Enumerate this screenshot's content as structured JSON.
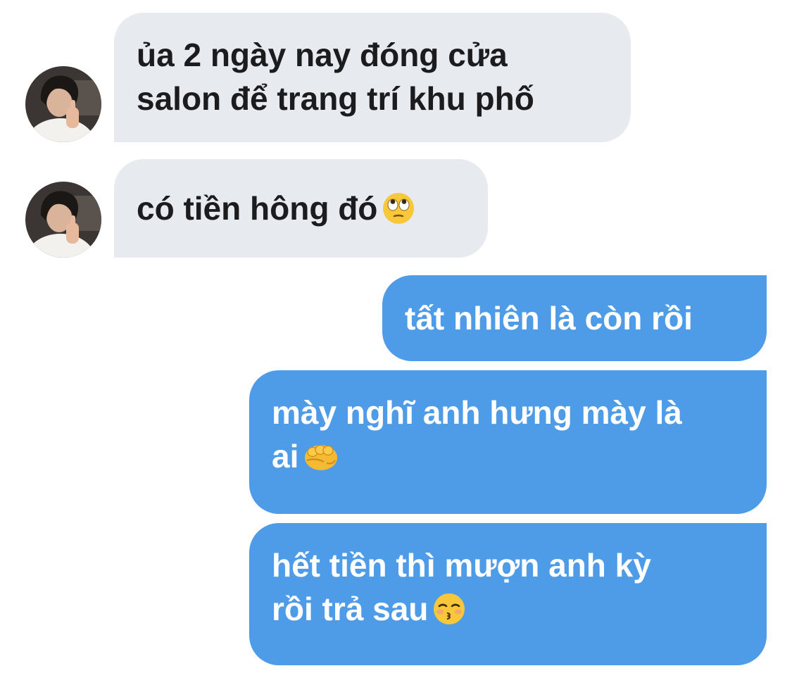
{
  "messages": [
    {
      "direction": "incoming",
      "lines": [
        "ủa 2 ngày nay đóng cửa",
        "salon để trang trí khu phố"
      ]
    },
    {
      "direction": "incoming",
      "lines": [
        "có tiền hông đó"
      ],
      "emoji": "face-with-rolling-eyes-emoji"
    },
    {
      "direction": "outgoing",
      "lines": [
        "tất nhiên là còn rồi"
      ]
    },
    {
      "direction": "outgoing",
      "lines": [
        "mày nghĩ anh hưng mày là",
        "ai"
      ],
      "emoji": "oncoming-fist-emoji"
    },
    {
      "direction": "outgoing",
      "lines": [
        "hết tiền thì mượn anh kỳ",
        "rồi trả sau"
      ],
      "emoji": "kissing-face-with-closed-eyes-emoji"
    }
  ],
  "colors": {
    "incoming_bubble": "#e7eaee",
    "incoming_text": "#1c1c1e",
    "outgoing_bubble": "#4e9ce8",
    "outgoing_text": "#ffffff"
  }
}
